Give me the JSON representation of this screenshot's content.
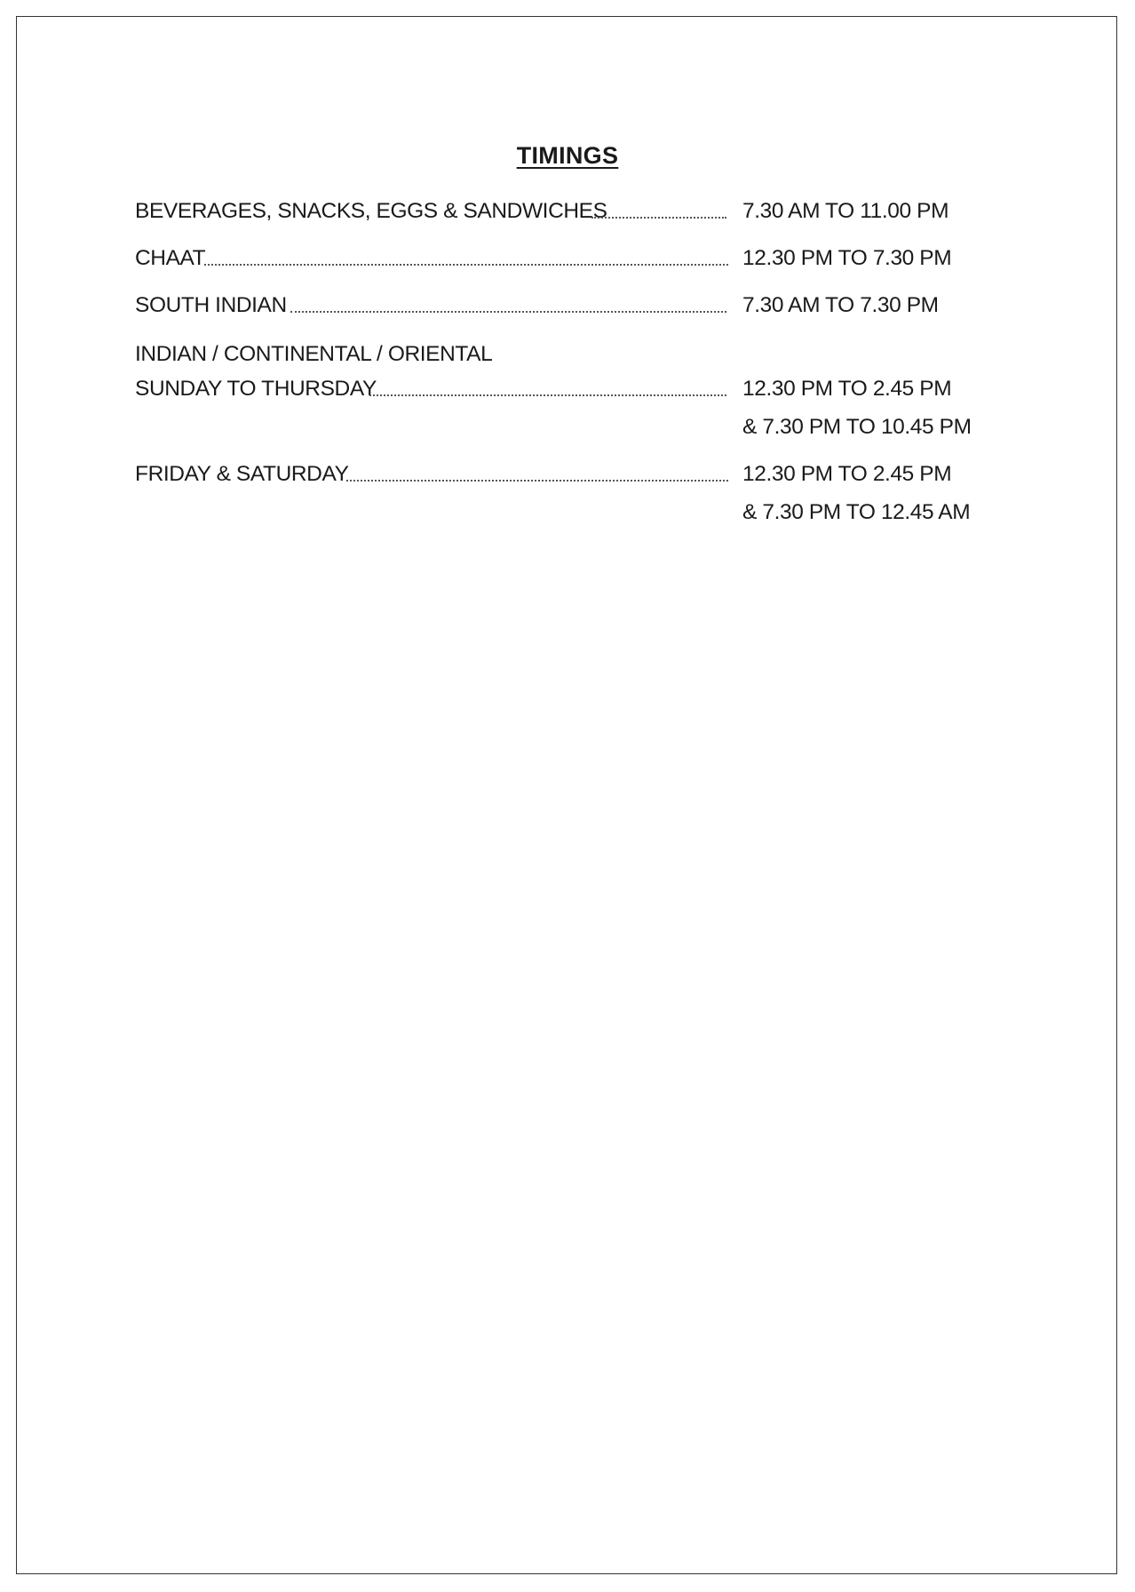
{
  "title": "TIMINGS",
  "rows": [
    {
      "label": "BEVERAGES, SNACKS, EGGS & SANDWICHES",
      "time": "7.30 AM TO 11.00 PM"
    },
    {
      "label": "CHAAT",
      "time": "12.30 PM TO 7.30 PM"
    },
    {
      "label": "SOUTH INDIAN",
      "time": "7.30 AM TO 7.30 PM"
    },
    {
      "label": "INDIAN / CONTINENTAL / ORIENTAL"
    },
    {
      "label": "SUNDAY TO THURSDAY",
      "time": "12.30 PM TO 2.45 PM"
    },
    {
      "time": "& 7.30 PM TO 10.45 PM"
    },
    {
      "label": "FRIDAY & SATURDAY",
      "time": "12.30 PM TO 2.45 PM"
    },
    {
      "time": "& 7.30 PM TO 12.45 AM"
    }
  ]
}
